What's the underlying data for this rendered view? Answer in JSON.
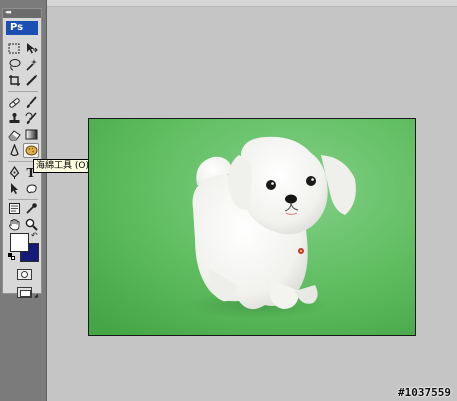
{
  "app": {
    "logo_text": "Ps"
  },
  "tooltip": {
    "text": "海綿工具 (O)"
  },
  "tools": [
    "rectangular-marquee",
    "move",
    "lasso",
    "magic-wand",
    "crop",
    "slice",
    "healing-brush",
    "brush",
    "clone-stamp",
    "history-brush",
    "eraser",
    "gradient",
    "blur",
    "sponge",
    "pen",
    "type",
    "path-selection",
    "custom-shape",
    "notes",
    "eyedropper",
    "hand",
    "zoom"
  ],
  "active_tool": "sponge",
  "colors": {
    "foreground": "#ffffff",
    "background": "#141a78"
  },
  "canvas": {
    "description_color": "#55b856"
  },
  "watermark": {
    "text": "#1037559"
  }
}
